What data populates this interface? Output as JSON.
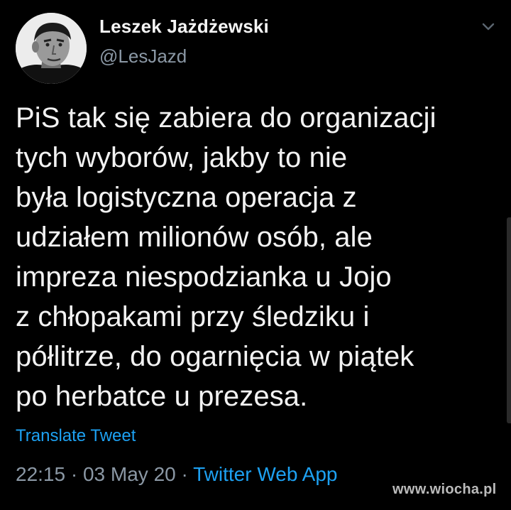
{
  "author": {
    "display_name": "Leszek Jażdżewski",
    "handle": "@LesJazd"
  },
  "tweet": {
    "lines": [
      "PiS tak się zabiera do organizacji",
      "tych wyborów, jakby to nie",
      "była logistyczna operacja z",
      "udziałem milionów osób, ale",
      "impreza niespodzianka u Jojo",
      "z chłopakami przy śledziku i",
      "półlitrze, do ogarnięcia w piątek",
      "po herbatce u prezesa."
    ],
    "translate_label": "Translate Tweet",
    "time": "22:15",
    "date": "03 May 20",
    "separator": "·",
    "source": "Twitter Web App"
  },
  "overlay": {
    "watermark": "www.wiocha.pl"
  },
  "icons": {
    "avatar": "profile-photo",
    "menu": "chevron-down-icon"
  },
  "colors": {
    "background": "#000000",
    "text": "#f2f2f2",
    "secondary": "#8b98a5",
    "link": "#1da1f2"
  }
}
